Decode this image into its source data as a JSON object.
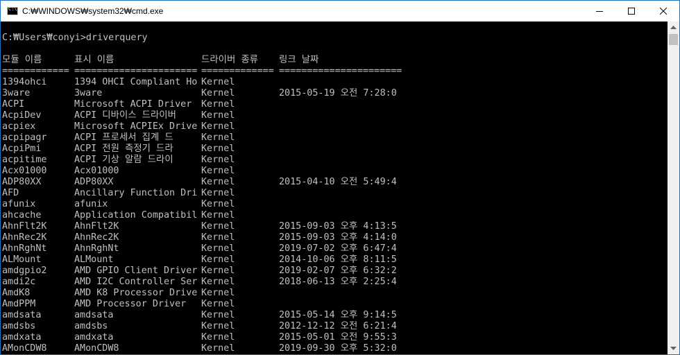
{
  "window": {
    "title": "C:₩WINDOWS₩system32₩cmd.exe",
    "accent_color": "#1a73c8",
    "icons": {
      "app": "cmd-icon",
      "minimize": "minimize-icon",
      "maximize": "maximize-icon",
      "close": "close-icon"
    }
  },
  "console": {
    "prompt_line": "C:₩Users₩conyi>driverquery",
    "headers": [
      "모듈 이름",
      "표시 이름",
      "드라이버 종류",
      "링크 날짜"
    ],
    "separators": [
      "============",
      "======================",
      "=============",
      "======================"
    ],
    "rows": [
      [
        "1394ohci",
        "1394 OHCI Compliant Ho",
        "Kernel",
        ""
      ],
      [
        "3ware",
        "3ware",
        "Kernel",
        "2015-05-19 오전 7:28:0"
      ],
      [
        "ACPI",
        "Microsoft ACPI Driver",
        "Kernel",
        ""
      ],
      [
        "AcpiDev",
        "ACPI 디바이스 드라이버",
        "Kernel",
        ""
      ],
      [
        "acpiex",
        "Microsoft ACPIEx Drive",
        "Kernel",
        ""
      ],
      [
        "acpipagr",
        "ACPI 프로세서 집계 드",
        "Kernel",
        ""
      ],
      [
        "AcpiPmi",
        "ACPI 전원 측정기 드라",
        "Kernel",
        ""
      ],
      [
        "acpitime",
        "ACPI 기상 알람 드라이",
        "Kernel",
        ""
      ],
      [
        "Acx01000",
        "Acx01000",
        "Kernel",
        ""
      ],
      [
        "ADP80XX",
        "ADP80XX",
        "Kernel",
        "2015-04-10 오전 5:49:4"
      ],
      [
        "AFD",
        "Ancillary Function Dri",
        "Kernel",
        ""
      ],
      [
        "afunix",
        "afunix",
        "Kernel",
        ""
      ],
      [
        "ahcache",
        "Application Compatibil",
        "Kernel",
        ""
      ],
      [
        "AhnFlt2K",
        "AhnFlt2K",
        "Kernel",
        "2015-09-03 오후 4:13:5"
      ],
      [
        "AhnRec2K",
        "AhnRec2K",
        "Kernel",
        "2015-09-03 오후 4:14:0"
      ],
      [
        "AhnRghNt",
        "AhnRghNt",
        "Kernel",
        "2019-07-02 오후 6:47:4"
      ],
      [
        "ALMount",
        "ALMount",
        "Kernel",
        "2014-10-06 오후 8:11:5"
      ],
      [
        "amdgpio2",
        "AMD GPIO Client Driver",
        "Kernel",
        "2019-02-07 오후 6:32:2"
      ],
      [
        "amdi2c",
        "AMD I2C Controller Ser",
        "Kernel",
        "2018-06-13 오후 2:25:4"
      ],
      [
        "AmdK8",
        "AMD K8 Processor Drive",
        "Kernel",
        ""
      ],
      [
        "AmdPPM",
        "AMD Processor Driver",
        "Kernel",
        ""
      ],
      [
        "amdsata",
        "amdsata",
        "Kernel",
        "2015-05-14 오후 9:14:5"
      ],
      [
        "amdsbs",
        "amdsbs",
        "Kernel",
        "2012-12-12 오전 6:21:4"
      ],
      [
        "amdxata",
        "amdxata",
        "Kernel",
        "2015-05-01 오전 9:55:3"
      ],
      [
        "AMonCDW8",
        "AMonCDW8",
        "Kernel",
        "2019-09-30 오후 5:32:0"
      ]
    ]
  },
  "scrollbar": {
    "icons": {
      "up": "scroll-up-arrow-icon",
      "down": "scroll-down-arrow-icon"
    }
  }
}
